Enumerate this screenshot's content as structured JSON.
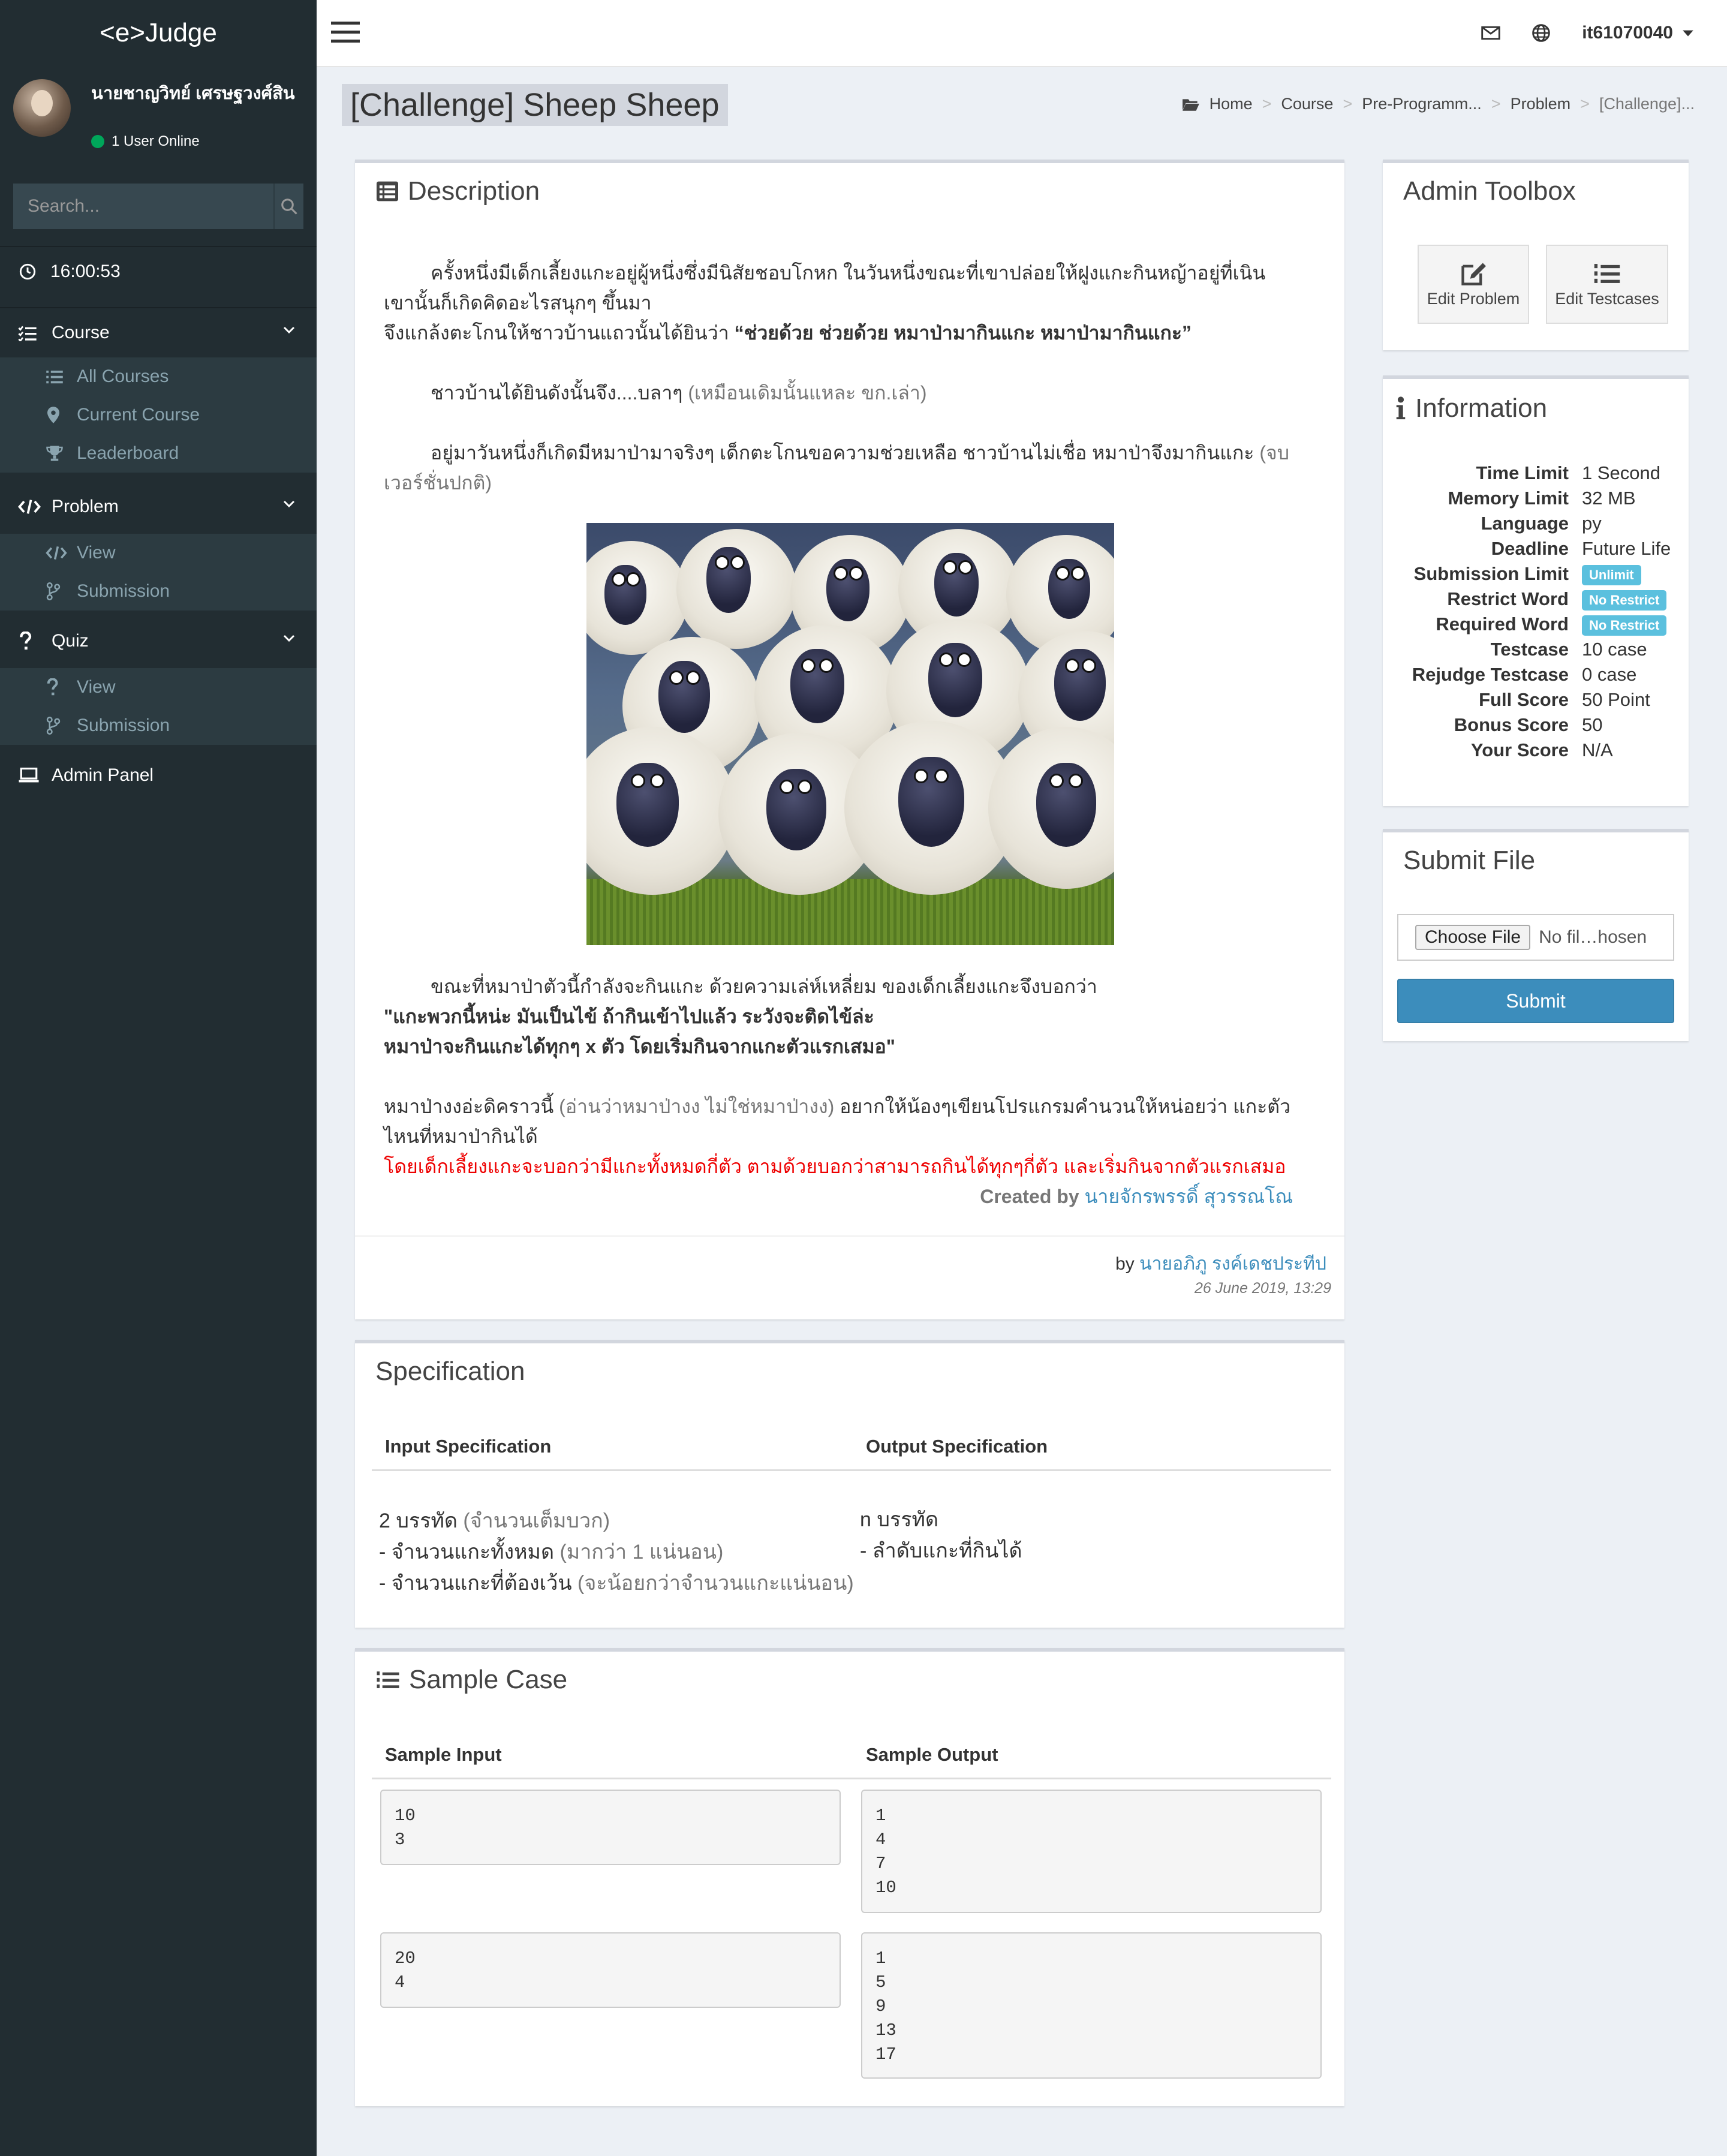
{
  "app": {
    "brand": "<e>Judge"
  },
  "user": {
    "name": "นายชาญวิทย์ เศรษฐวงศ์สิน",
    "online": "1 User Online"
  },
  "search": {
    "placeholder": "Search..."
  },
  "clock": "16:00:53",
  "sidebar": {
    "course": {
      "label": "Course",
      "items": [
        "All Courses",
        "Current Course",
        "Leaderboard"
      ]
    },
    "problem": {
      "label": "Problem",
      "items": [
        "View",
        "Submission"
      ]
    },
    "quiz": {
      "label": "Quiz",
      "items": [
        "View",
        "Submission"
      ]
    },
    "admin": "Admin Panel"
  },
  "topnav": {
    "username": "it61070040"
  },
  "page": {
    "title": "[Challenge] Sheep Sheep"
  },
  "breadcrumb": [
    "Home",
    "Course",
    "Pre-Programm...",
    "Problem",
    "[Challenge]..."
  ],
  "description": {
    "title": "Description",
    "p1a": "ครั้งหนึ่งมีเด็กเลี้ยงแกะอยู่ผู้หนึ่งซึ่งมีนิสัยชอบโกหก ในวันหนึ่งขณะที่เขาปล่อยให้ฝูงแกะกินหญ้าอยู่ที่เนิน",
    "p1b": "เขานั้นก็เกิดคิดอะไรสนุกๆ ขึ้นมา",
    "p1c": "จึงแกล้งตะโกนให้ชาวบ้านแถวนั้นได้ยินว่า ",
    "p1d": "“ช่วยด้วย ช่วยด้วย หมาป่ามากินแกะ หมาป่ามากินแกะ”",
    "p2a": "ชาวบ้านได้ยินดังนั้นจึง....บลาๆ ",
    "p2b": "(เหมือนเดิมนั้นแหละ ขก.เล่า)",
    "p3a": "อยู่มาวันหนึ่งก็เกิดมีหมาป่ามาจริงๆ เด็กตะโกนขอความช่วยเหลือ ชาวบ้านไม่เชื่อ หมาป่าจึงมากินแกะ ",
    "p3b": "(จบ",
    "p3c": "เวอร์ชั่นปกติ)",
    "p4a": "ขณะที่หมาป่าตัวนี้กำลังจะกินแกะ ด้วยความเล่ห์เหลี่ยม ของเด็กเลี้ยงแกะจึงบอกว่า",
    "p4b": "\"แกะพวกนี้หน่ะ มันเป็นไข้ ถ้ากินเข้าไปแล้ว ระวังจะติดไข้ล่ะ",
    "p4c": "หมาป่าจะกินแกะได้ทุกๆ x ตัว โดยเริ่มกินจากแกะตัวแรกเสมอ\"",
    "p5a": "หมาป่างงอ่ะดิคราวนี้ ",
    "p5b": "(อ่านว่าหมาป่างง ไม่ใช่หมาป่างง)",
    "p5c": " อยากให้น้องๆเขียนโปรแกรมคำนวนให้หน่อยว่า แกะตัว",
    "p5d": "ไหนที่หมาป่ากินได้",
    "p6": "โดยเด็กเลี้ยงแกะจะบอกว่ามีแกะทั้งหมดกี่ตัว ตามด้วยบอกว่าสามารถกินได้ทุกๆกี่ตัว และเริ่มกินจากตัวแรกเสมอ",
    "created_label": "Created by ",
    "created_name": "นายจักรพรรดิ์ สุวรรณโณ",
    "by_label": "by ",
    "by_name": "นายอภิภู รงค์เดชประทีป",
    "date": "26 June 2019, 13:29"
  },
  "specification": {
    "title": "Specification",
    "input_header": "Input Specification",
    "output_header": "Output Specification",
    "input_lines": [
      [
        "2 บรรทัด ",
        "(จำนวนเต็มบวก)"
      ],
      [
        "- จำนวนแกะทั้งหมด ",
        "(มากว่า 1 แน่นอน)"
      ],
      [
        "- จำนวนแกะที่ต้องเว้น ",
        "(จะน้อยกว่าจำนวนแกะแน่นอน)"
      ]
    ],
    "output_lines": [
      "n บรรทัด",
      "- ลำดับแกะที่กินได้"
    ]
  },
  "sample": {
    "title": "Sample Case",
    "input_header": "Sample Input",
    "output_header": "Sample Output",
    "cases": [
      {
        "input": "10\n3",
        "output": "1\n4\n7\n10"
      },
      {
        "input": "20\n4",
        "output": "1\n5\n9\n13\n17"
      }
    ]
  },
  "toolbox": {
    "title": "Admin Toolbox",
    "edit_problem": "Edit Problem",
    "edit_testcases": "Edit Testcases"
  },
  "information": {
    "title": "Information",
    "rows": [
      {
        "k": "Time Limit",
        "v": "1 Second"
      },
      {
        "k": "Memory Limit",
        "v": "32 MB"
      },
      {
        "k": "Language",
        "v": "py"
      },
      {
        "k": "Deadline",
        "v": "Future Life"
      },
      {
        "k": "Submission Limit",
        "badge": "Unlimit"
      },
      {
        "k": "Restrict Word",
        "badge": "No Restrict"
      },
      {
        "k": "Required Word",
        "badge": "No Restrict"
      },
      {
        "k": "Testcase",
        "v": "10 case"
      },
      {
        "k": "Rejudge Testcase",
        "v": "0 case"
      },
      {
        "k": "Full Score",
        "v": "50 Point"
      },
      {
        "k": "Bonus Score",
        "v": "50"
      },
      {
        "k": "Your Score",
        "v": "N/A"
      }
    ]
  },
  "submit": {
    "title": "Submit File",
    "choose": "Choose File",
    "no_file": "No fil…hosen",
    "button": "Submit"
  },
  "colors": {
    "sidebar": "#222d32",
    "accent": "#3c8dbc",
    "badge": "#5bc0de",
    "red": "#e00000"
  }
}
